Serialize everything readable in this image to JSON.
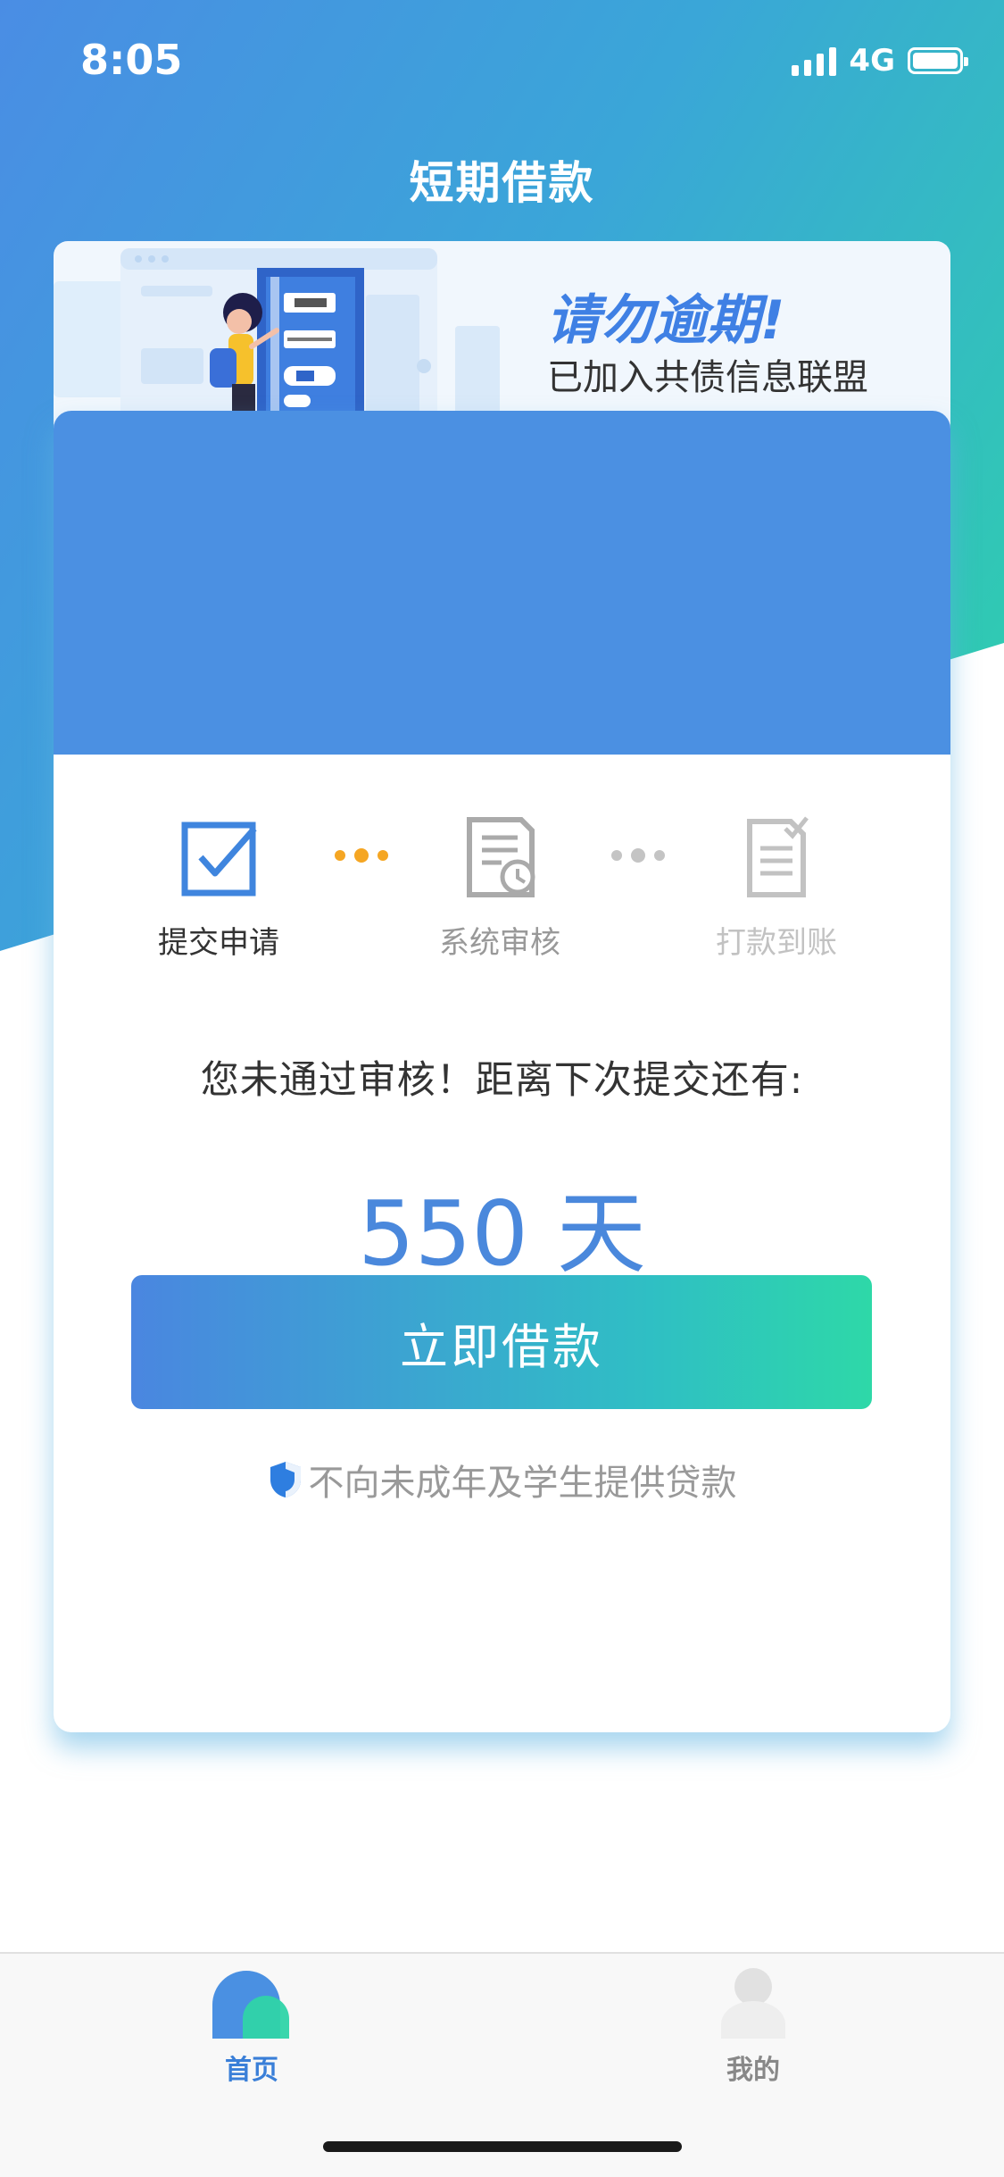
{
  "status_bar": {
    "time": "8:05",
    "network": "4G",
    "signal_bars": 4,
    "battery_level": 1.0
  },
  "header": {
    "title": "短期借款"
  },
  "banner": {
    "headline": "请勿逾期!",
    "subline": "已加入共债信息联盟"
  },
  "steps": [
    {
      "label": "提交申请",
      "icon": "checkbox-check-icon",
      "state": "active"
    },
    {
      "label": "系统审核",
      "icon": "document-clock-icon",
      "state": "pending"
    },
    {
      "label": "打款到账",
      "icon": "document-check-icon",
      "state": "inactive"
    }
  ],
  "review": {
    "message": "您未通过审核！距离下次提交还有:",
    "countdown": "550 天",
    "loan_button": "立即借款",
    "notice": "不向未成年及学生提供贷款",
    "notice_icon": "shield-icon"
  },
  "tabbar": {
    "items": [
      {
        "label": "首页",
        "icon": "home-icon",
        "active": true
      },
      {
        "label": "我的",
        "icon": "profile-icon",
        "active": false
      }
    ]
  },
  "colors": {
    "brand_blue": "#4a8de4",
    "brand_green": "#2ed4a8",
    "step_orange": "#f5a623",
    "muted_gray": "#bbbbbb"
  }
}
